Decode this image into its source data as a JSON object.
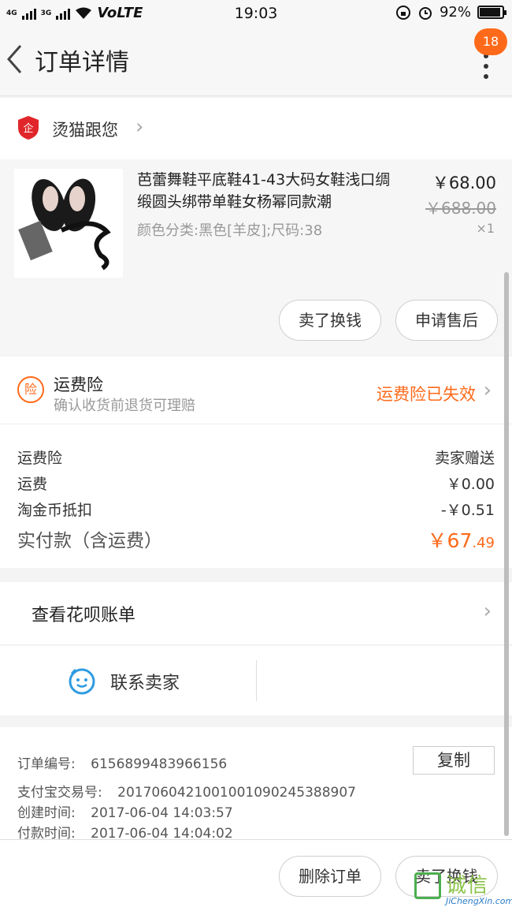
{
  "status_bar": {
    "network_1": "4G",
    "network_2": "3G",
    "volte": "VoLTE",
    "time": "19:03",
    "battery": "92%",
    "battery_level": 0.92
  },
  "header": {
    "title": "订单详情",
    "badge_count": "18"
  },
  "store": {
    "name": "烫猫跟您"
  },
  "item": {
    "title": "芭蕾舞鞋平底鞋41-43大码女鞋浅口绸缎圆头绑带单鞋女杨幂同款潮",
    "spec": "颜色分类:黑色[羊皮];尺码:38",
    "price": "￥68.00",
    "original_price": "￥688.00",
    "quantity": "×1",
    "actions": [
      "卖了换钱",
      "申请售后"
    ]
  },
  "insurance": {
    "icon_text": "险",
    "title": "运费险",
    "subtitle": "确认收货前退货可理赔",
    "status": "运费险已失效"
  },
  "costs": {
    "rows": [
      {
        "label": "运费险",
        "value": "卖家赠送"
      },
      {
        "label": "运费",
        "value": "￥0.00"
      },
      {
        "label": "淘金币抵扣",
        "value": "-￥0.51"
      }
    ],
    "total_label": "实付款（含运费）",
    "total_main": "￥67",
    "total_decimal": ".49"
  },
  "huabei": {
    "label": "查看花呗账单"
  },
  "contact": {
    "label": "联系卖家"
  },
  "order_info": {
    "order_no_label": "订单编号:",
    "order_no": "6156899483966156",
    "copy_label": "复制",
    "alipay_label": "支付宝交易号:",
    "alipay_no": "2017060421001001090245388907",
    "created_label": "创建时间:",
    "created": "2017-06-04 14:03:57",
    "paid_label": "付款时间:",
    "paid": "2017-06-04 14:04:02"
  },
  "footer": {
    "actions": [
      "删除订单",
      "卖了换钱"
    ]
  },
  "watermark": {
    "text": "诚信",
    "sub": "JiChengXin.com"
  },
  "colors": {
    "accent": "#ff6a1a",
    "contact_icon": "#2f9be0"
  }
}
